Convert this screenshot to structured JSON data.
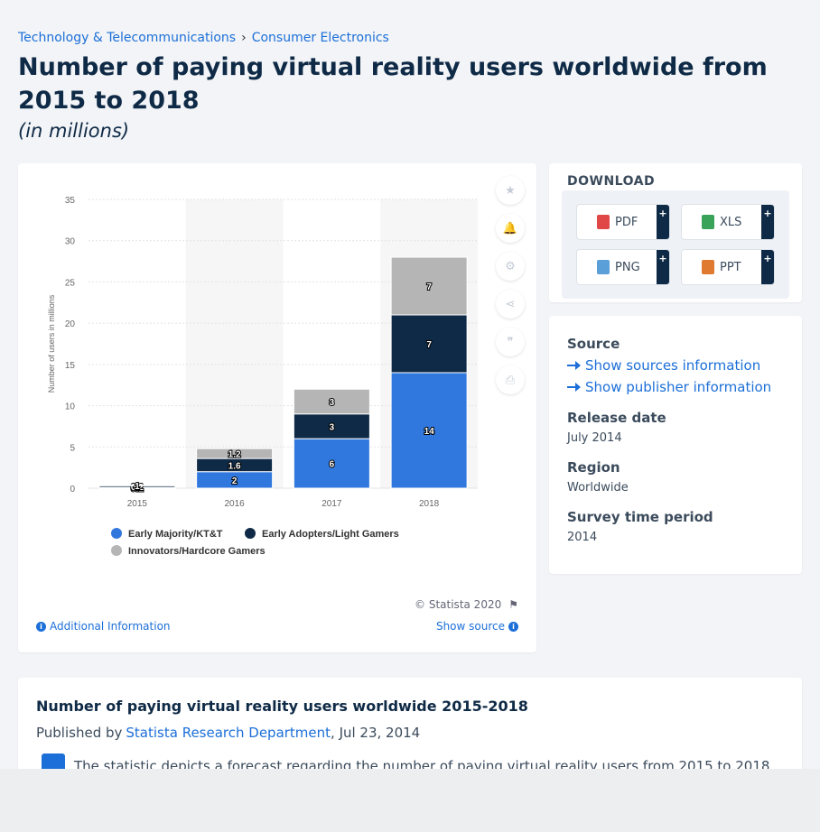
{
  "breadcrumb": {
    "item1": "Technology & Telecommunications",
    "separator": "›",
    "item2": "Consumer Electronics"
  },
  "title": "Number of paying virtual reality users worldwide from 2015 to 2018",
  "subtitle": "(in millions)",
  "chart_data": {
    "type": "bar",
    "stacked": true,
    "categories": [
      "2015",
      "2016",
      "2017",
      "2018"
    ],
    "series": [
      {
        "name": "Early Majority/KT&T",
        "color": "#3178de",
        "values": [
          0.1,
          2,
          6,
          14
        ],
        "labels": [
          "0.1",
          "2",
          "6",
          "14"
        ]
      },
      {
        "name": "Early Adopters/Light Gamers",
        "color": "#0f2a46",
        "values": [
          0.2,
          1.6,
          3,
          7
        ],
        "labels": [
          "0.2",
          "1.6",
          "3",
          "7"
        ]
      },
      {
        "name": "Innovators/Hardcore Gamers",
        "color": "#b5b5b5",
        "values": [
          0.1,
          1.2,
          3,
          7
        ],
        "labels": [
          "1",
          "1.2",
          "3",
          "7"
        ]
      }
    ],
    "ylabel": "Number of users in millions",
    "xlabel": "",
    "ylim": [
      0,
      35
    ],
    "yticks": [
      "0",
      "5",
      "10",
      "15",
      "20",
      "25",
      "30",
      "35"
    ],
    "grid": true,
    "legend_position": "bottom"
  },
  "chart_footer": {
    "copyright": "© Statista 2020",
    "additional_info": "Additional Information",
    "show_source": "Show source"
  },
  "tools": [
    "star-icon",
    "bell-icon",
    "gear-icon",
    "share-icon",
    "quote-icon",
    "print-icon"
  ],
  "download": {
    "heading": "DOWNLOAD",
    "pdf": "PDF",
    "xls": "XLS",
    "png": "PNG",
    "ppt": "PPT",
    "plus": "+"
  },
  "info": {
    "source_label": "Source",
    "show_sources": "Show sources information",
    "show_publisher": "Show publisher information",
    "release_label": "Release date",
    "release_value": "July 2014",
    "region_label": "Region",
    "region_value": "Worldwide",
    "survey_label": "Survey time period",
    "survey_value": "2014"
  },
  "description": {
    "title": "Number of paying virtual reality users worldwide 2015-2018",
    "published_by": "Published by",
    "author": "Statista Research Department",
    "date": ", Jul 23, 2014",
    "text": "The statistic depicts a forecast regarding the number of paying virtual reality users from 2015 to 2018."
  },
  "colors": {
    "accent": "#1c6fd8",
    "navy": "#0f2a46"
  }
}
